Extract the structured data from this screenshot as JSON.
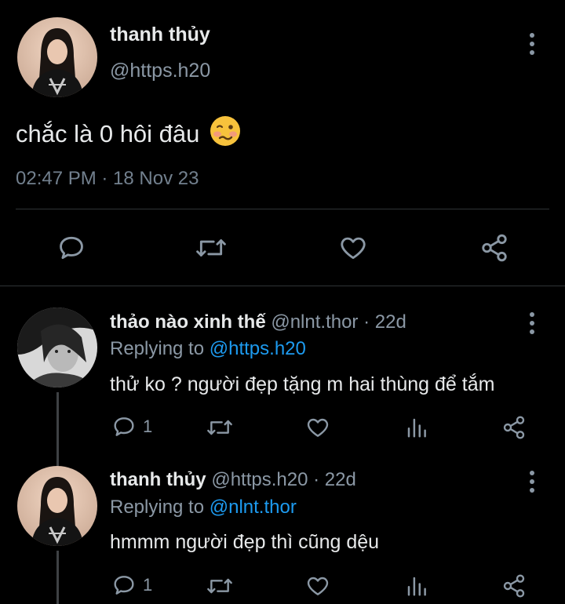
{
  "main_tweet": {
    "name": "thanh thủy",
    "handle": "@https.h20",
    "text": "chắc là 0 hôi đâu",
    "emoji_icon": "woozy-face-icon",
    "timestamp": "02:47 PM · 18 Nov 23"
  },
  "replies": [
    {
      "name": "thảo nào xinh thế",
      "handle": "@nlnt.thor",
      "separator": "·",
      "time": "22d",
      "replying_prefix": "Replying to",
      "replying_to": "@https.h20",
      "text": "thử ko ? người đẹp tặng m hai thùng để tắm",
      "reply_count": "1"
    },
    {
      "name": "thanh thủy",
      "handle": "@https.h20",
      "separator": "·",
      "time": "22d",
      "replying_prefix": "Replying to",
      "replying_to": "@nlnt.thor",
      "text": "hmmm người đẹp thì cũng dệu",
      "reply_count": "1"
    }
  ],
  "colors": {
    "background": "#000000",
    "text": "#e7e9ea",
    "secondary": "#8b98a5",
    "link": "#1d9bf0",
    "divider": "#2f3336"
  }
}
